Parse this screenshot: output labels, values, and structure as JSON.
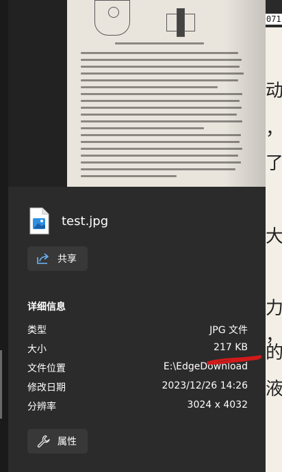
{
  "file": {
    "name": "test.jpg"
  },
  "actions": {
    "share_label": "共享",
    "properties_label": "属性"
  },
  "details": {
    "title": "详细信息",
    "rows": [
      {
        "key": "类型",
        "value": "JPG 文件"
      },
      {
        "key": "大小",
        "value": "217 KB"
      },
      {
        "key": "文件位置",
        "value": "E:\\EdgeDownload"
      },
      {
        "key": "修改日期",
        "value": "2023/12/26 14:26"
      },
      {
        "key": "分辨率",
        "value": "3024 x 4032"
      }
    ]
  },
  "background": {
    "code_text": "071"
  },
  "icons": [
    "image-file-icon",
    "share-icon",
    "wrench-icon"
  ],
  "colors": {
    "panel": "#2b2b2b",
    "button": "#383838",
    "annotation": "#d11a1a"
  }
}
